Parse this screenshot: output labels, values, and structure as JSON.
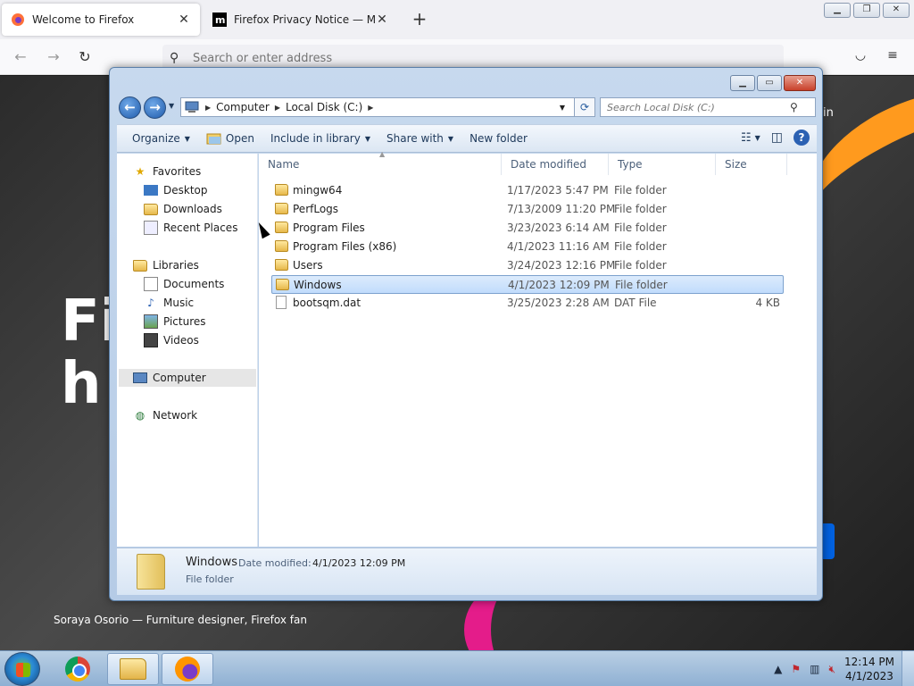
{
  "firefox": {
    "tabs": [
      {
        "title": "Welcome to Firefox",
        "active": true
      },
      {
        "title": "Firefox Privacy Notice — Mozilla",
        "active": false
      }
    ],
    "new_tab_glyph": "+",
    "close_glyph": "✕",
    "url_placeholder": "Search or enter address",
    "hero_text_line1": "Fi",
    "hero_text_line2": "h",
    "credit": "Soraya Osorio — Furniture designer, Firefox fan",
    "partial_right_text": "in"
  },
  "explorer": {
    "breadcrumb": [
      "Computer",
      "Local Disk (C:)"
    ],
    "search_placeholder": "Search Local Disk (C:)",
    "toolbar": {
      "organize": "Organize",
      "open": "Open",
      "include_in_library": "Include in library",
      "share_with": "Share with",
      "new_folder": "New folder"
    },
    "nav": {
      "favorites": "Favorites",
      "favorites_items": [
        "Desktop",
        "Downloads",
        "Recent Places"
      ],
      "libraries": "Libraries",
      "libraries_items": [
        "Documents",
        "Music",
        "Pictures",
        "Videos"
      ],
      "computer": "Computer",
      "network": "Network"
    },
    "columns": {
      "name": "Name",
      "date": "Date modified",
      "type": "Type",
      "size": "Size"
    },
    "rows": [
      {
        "name": "mingw64",
        "date": "1/17/2023 5:47 PM",
        "type": "File folder",
        "size": "",
        "kind": "folder"
      },
      {
        "name": "PerfLogs",
        "date": "7/13/2009 11:20 PM",
        "type": "File folder",
        "size": "",
        "kind": "folder"
      },
      {
        "name": "Program Files",
        "date": "3/23/2023 6:14 AM",
        "type": "File folder",
        "size": "",
        "kind": "folder"
      },
      {
        "name": "Program Files (x86)",
        "date": "4/1/2023 11:16 AM",
        "type": "File folder",
        "size": "",
        "kind": "folder"
      },
      {
        "name": "Users",
        "date": "3/24/2023 12:16 PM",
        "type": "File folder",
        "size": "",
        "kind": "folder"
      },
      {
        "name": "Windows",
        "date": "4/1/2023 12:09 PM",
        "type": "File folder",
        "size": "",
        "kind": "folder",
        "selected": true
      },
      {
        "name": "bootsqm.dat",
        "date": "3/25/2023 2:28 AM",
        "type": "DAT File",
        "size": "4 KB",
        "kind": "file"
      }
    ],
    "details": {
      "name": "Windows",
      "date_label": "Date modified:",
      "date_value": "4/1/2023 12:09 PM",
      "type": "File folder"
    }
  },
  "taskbar": {
    "clock_time": "12:14 PM",
    "clock_date": "4/1/2023",
    "tray_arrow": "▲"
  },
  "colors": {
    "selection": "#c1dcfc",
    "firefox_blue": "#0061e0",
    "orange": "#ff9a1e",
    "pink": "#e41c8a"
  }
}
